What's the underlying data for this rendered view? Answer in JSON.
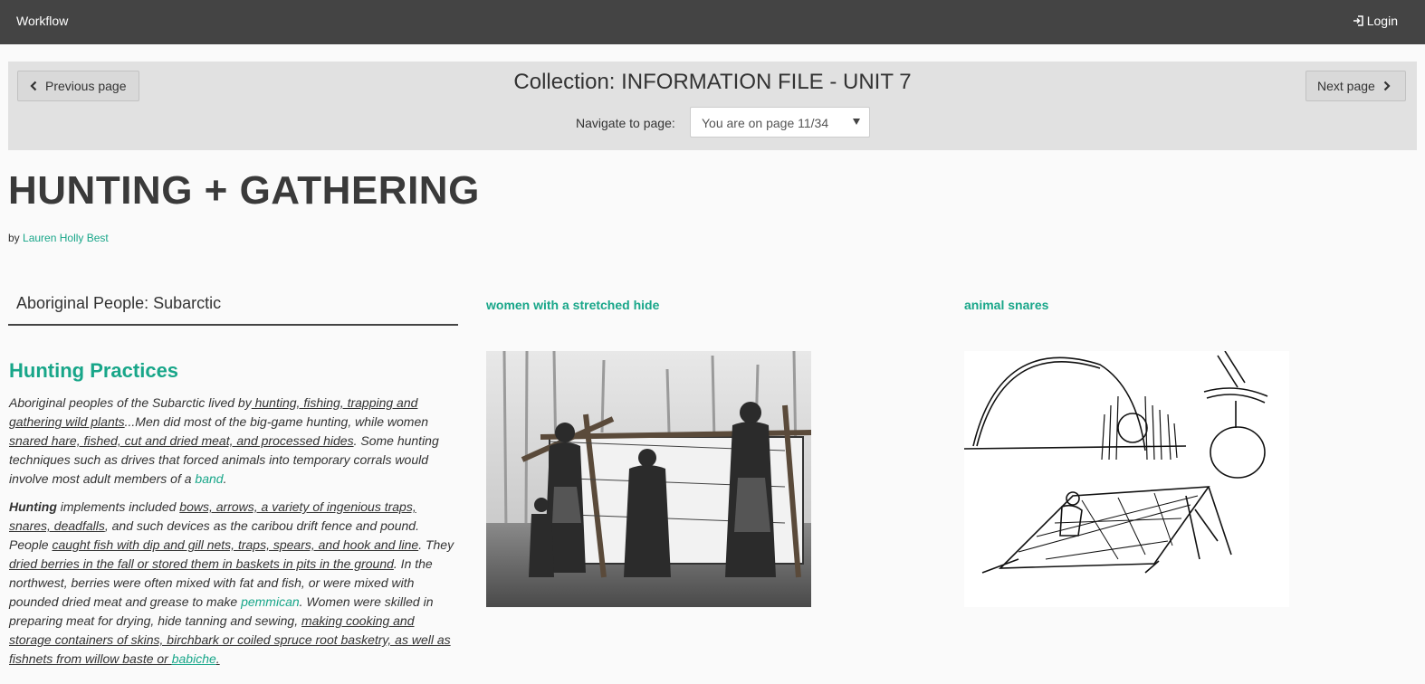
{
  "navbar": {
    "brand": "Workflow",
    "login_label": "Login"
  },
  "collection": {
    "title": "Collection: INFORMATION FILE - UNIT 7",
    "prev_label": "Previous page",
    "next_label": "Next page",
    "navigate_label": "Navigate to page:",
    "page_select_value": "You are on page 11/34"
  },
  "page": {
    "heading": "HUNTING + GATHERING",
    "by_prefix": "by",
    "author": "Lauren Holly Best"
  },
  "column_left": {
    "tab_heading": "Aboriginal People: Subarctic",
    "section_title": "Hunting Practices",
    "p1": [
      "Aboriginal peoples of the Subarctic lived by",
      " hunting, fishing, trapping and gathering wild plants",
      "...Men did most of the big-game hunting, while women ",
      "snared hare, fished, cut and dried meat, and processed hides",
      ". Some hunting techniques such as drives that forced animals into temporary corrals would involve most adult members of a ",
      "band",
      "."
    ],
    "p2": [
      "Hunting",
      " implements included ",
      "bows, arrows, a variety of ingenious traps, snares, deadfalls",
      ", and such devices as the caribou drift fence and pound. People ",
      "caught fish with dip and gill nets, traps, spears, and hook and line",
      ". They ",
      "dried berries in the fall or stored them in baskets in pits in the ground",
      ". In the northwest, berries were often mixed with fat and fish, or were mixed with pounded dried meat and grease to make ",
      "pemmican",
      ". Women were skilled in preparing meat for drying, hide tanning and sewing, ",
      "making cooking and storage containers of skins, birchbark or coiled spruce root basketry, as well as fishnets from willow baste or ",
      "babiche",
      "."
    ]
  },
  "column_mid": {
    "image_title": "women with a stretched hide"
  },
  "column_right": {
    "image_title": "animal snares"
  }
}
